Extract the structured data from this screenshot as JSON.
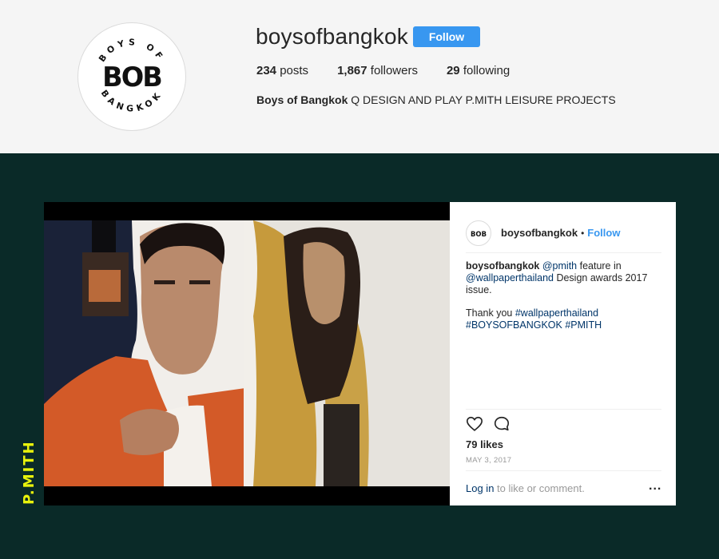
{
  "profile": {
    "username": "boysofbangkok",
    "follow_label": "Follow",
    "posts_count": "234",
    "posts_label": "posts",
    "followers_count": "1,867",
    "followers_label": "followers",
    "following_count": "29",
    "following_label": "following",
    "bio_name": "Boys of Bangkok",
    "bio_text": " Q DESIGN AND PLAY P.MITH LEISURE PROJECTS",
    "logo_text_top": "BOYS OF",
    "logo_main": "BOB",
    "logo_text_bottom": "BANGKOK"
  },
  "side_label": "P.MITH",
  "post": {
    "username": "boysofbangkok",
    "separator": "•",
    "follow_label": "Follow",
    "caption_user": "boysofbangkok",
    "caption_mention_1": "@pmith",
    "caption_text_1": " feature in ",
    "caption_mention_2": "@wallpaperthailand",
    "caption_text_2": " Design awards 2017 issue.",
    "caption_thanks": "Thank you ",
    "caption_tag_1": "#wallpaperthailand",
    "caption_tag_2": "#BOYSOFBANGKOK",
    "caption_tag_3": "#PMITH",
    "likes": "79 likes",
    "date": "MAY 3, 2017",
    "login_link": "Log in",
    "login_text": " to like or comment.",
    "more": "..."
  },
  "icons": {
    "like": "heart-icon",
    "comment": "comment-icon",
    "more": "more-options-icon"
  },
  "colors": {
    "accent": "#3897f0",
    "link": "#003569",
    "background_dark": "#0a2a28",
    "side_label": "#e8f20c"
  }
}
